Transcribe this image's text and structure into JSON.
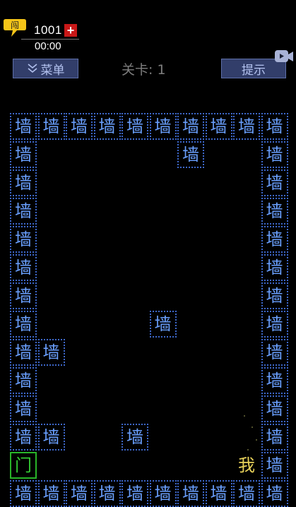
{
  "hud": {
    "coin_count": "1001",
    "plus_label": "+",
    "timer": "00:00",
    "menu_label": "菜单",
    "level_label": "关卡: 1",
    "hint_label": "提示",
    "coin_badge_glyph": "闯"
  },
  "icons": {
    "coin": "speech-bubble-coin-icon",
    "plus": "plus-icon",
    "menu_chevron": "double-chevron-down-icon",
    "video": "video-camera-icon"
  },
  "colors": {
    "background": "#000000",
    "wall_border": "#3d67c9",
    "wall_text": "#6aa0ff",
    "door": "#28b428",
    "player": "#e8d25a",
    "button_bg": "#323e6a",
    "button_text": "#b3c2ef",
    "plus_bg": "#c81818",
    "coin_yellow": "#f5c518"
  },
  "board": {
    "columns": 10,
    "rows": 14,
    "wall_label": "墙",
    "door_label": "门",
    "player_label": "我",
    "walls": [
      [
        0,
        0
      ],
      [
        1,
        0
      ],
      [
        2,
        0
      ],
      [
        3,
        0
      ],
      [
        4,
        0
      ],
      [
        5,
        0
      ],
      [
        6,
        0
      ],
      [
        7,
        0
      ],
      [
        8,
        0
      ],
      [
        9,
        0
      ],
      [
        0,
        1
      ],
      [
        6,
        1
      ],
      [
        9,
        1
      ],
      [
        0,
        2
      ],
      [
        9,
        2
      ],
      [
        0,
        3
      ],
      [
        9,
        3
      ],
      [
        0,
        4
      ],
      [
        9,
        4
      ],
      [
        0,
        5
      ],
      [
        9,
        5
      ],
      [
        0,
        6
      ],
      [
        9,
        6
      ],
      [
        0,
        7
      ],
      [
        5,
        7
      ],
      [
        9,
        7
      ],
      [
        0,
        8
      ],
      [
        1,
        8
      ],
      [
        9,
        8
      ],
      [
        0,
        9
      ],
      [
        9,
        9
      ],
      [
        0,
        10
      ],
      [
        9,
        10
      ],
      [
        0,
        11
      ],
      [
        1,
        11
      ],
      [
        4,
        11
      ],
      [
        9,
        11
      ],
      [
        9,
        12
      ],
      [
        0,
        13
      ],
      [
        1,
        13
      ],
      [
        2,
        13
      ],
      [
        3,
        13
      ],
      [
        4,
        13
      ],
      [
        5,
        13
      ],
      [
        6,
        13
      ],
      [
        7,
        13
      ],
      [
        8,
        13
      ],
      [
        9,
        13
      ]
    ],
    "door": [
      0,
      12
    ],
    "player": [
      8,
      12
    ]
  }
}
